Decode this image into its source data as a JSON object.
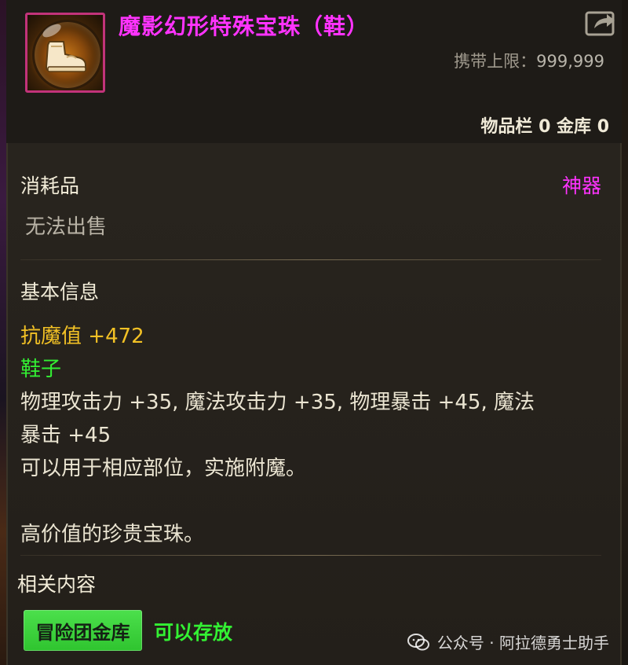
{
  "item": {
    "name": "魔影幻形特殊宝珠（鞋）",
    "icon": "boot-orb-icon",
    "frame_color": "#c2337a",
    "name_color": "#ff33ff"
  },
  "header": {
    "carry_limit_label": "携带上限：",
    "carry_limit_value": "999,999",
    "stock_text": "物品栏 0 金库 0",
    "share_icon": "share-export-icon"
  },
  "info": {
    "category": "消耗品",
    "rarity": "神器",
    "rarity_color": "#ff33ff",
    "sell_status": "无法出售"
  },
  "basic": {
    "title": "基本信息",
    "resist_label": "抗魔值",
    "resist_value": "+472",
    "slot": "鞋子",
    "stats_line1": "物理攻击力 +35, 魔法攻击力 +35, 物理暴击 +45, 魔法",
    "stats_line2": "暴击 +45",
    "usage": "可以用于相应部位，实施附魔。",
    "flavor": "高价值的珍贵宝珠。"
  },
  "related": {
    "title": "相关内容",
    "tag_label": "冒险团金库",
    "tag_status": "可以存放"
  },
  "watermark": {
    "text": "公众号 · 阿拉德勇士助手",
    "icon": "wechat-icon"
  }
}
